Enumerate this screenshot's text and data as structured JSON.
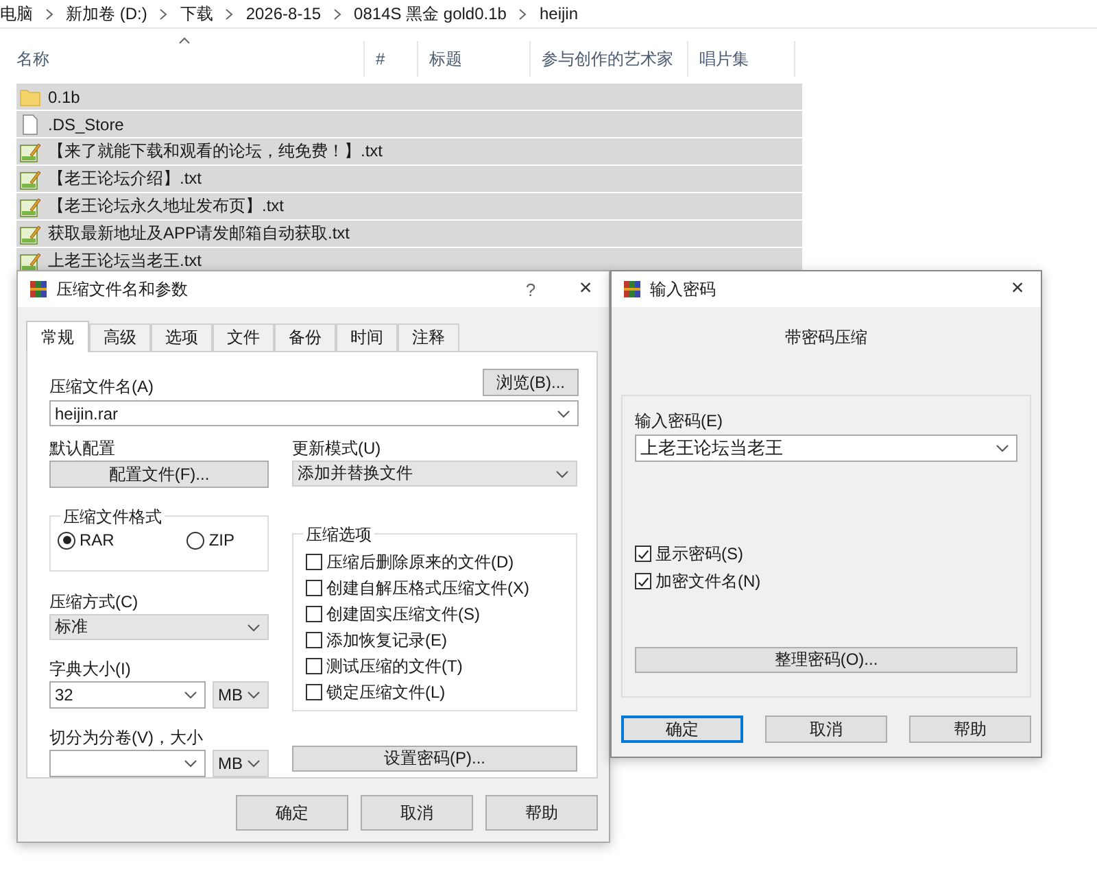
{
  "explorer": {
    "breadcrumb": [
      "电脑",
      "新加卷 (D:)",
      "下载",
      "2026-8-15",
      "0814S 黑金 gold0.1b",
      "heijin"
    ],
    "columns": [
      "名称",
      "#",
      "标题",
      "参与创作的艺术家",
      "唱片集"
    ],
    "files": [
      {
        "name": "0.1b",
        "kind": "folder",
        "selected": true
      },
      {
        "name": ".DS_Store",
        "kind": "file",
        "selected": true
      },
      {
        "name": "【来了就能下载和观看的论坛，纯免费！】.txt",
        "kind": "text",
        "selected": true
      },
      {
        "name": "【老王论坛介绍】.txt",
        "kind": "text",
        "selected": true
      },
      {
        "name": "【老王论坛永久地址发布页】.txt",
        "kind": "text",
        "selected": true
      },
      {
        "name": "获取最新地址及APP请发邮箱自动获取.txt",
        "kind": "text",
        "selected": true
      },
      {
        "name": "上老王论坛当老王.txt",
        "kind": "text",
        "selected": true
      }
    ]
  },
  "archive_dialog": {
    "title": "压缩文件名和参数",
    "help": "?",
    "close": "×",
    "tabs": [
      {
        "label": "常规",
        "selected": true
      },
      {
        "label": "高级",
        "selected": false
      },
      {
        "label": "选项",
        "selected": false
      },
      {
        "label": "文件",
        "selected": false
      },
      {
        "label": "备份",
        "selected": false
      },
      {
        "label": "时间",
        "selected": false
      },
      {
        "label": "注释",
        "selected": false
      }
    ],
    "archive_name": {
      "label": "压缩文件名(A)",
      "value": "heijin.rar",
      "browse": "浏览(B)..."
    },
    "profile": {
      "label": "默认配置",
      "button": "配置文件(F)..."
    },
    "update_mode": {
      "label": "更新模式(U)",
      "value": "添加并替换文件",
      "editable": false
    },
    "format": {
      "title": "压缩文件格式",
      "options": [
        {
          "label": "RAR",
          "selected": true
        },
        {
          "label": "ZIP",
          "selected": false
        }
      ]
    },
    "method": {
      "label": "压缩方式(C)",
      "value": "标准",
      "editable": false
    },
    "dictionary": {
      "label": "字典大小(I)",
      "value": "32",
      "unit": "MB"
    },
    "split": {
      "label": "切分为分卷(V)，大小",
      "unit": "MB"
    },
    "options": {
      "title": "压缩选项",
      "items": [
        {
          "label": "压缩后删除原来的文件(D)",
          "checked": false
        },
        {
          "label": "创建自解压格式压缩文件(X)",
          "checked": false
        },
        {
          "label": "创建固实压缩文件(S)",
          "checked": false
        },
        {
          "label": "添加恢复记录(E)",
          "checked": false
        },
        {
          "label": "测试压缩的文件(T)",
          "checked": false
        },
        {
          "label": "锁定压缩文件(L)",
          "checked": false
        }
      ]
    },
    "set_password": "设置密码(P)...",
    "buttons": [
      {
        "label": "确定",
        "default": false
      },
      {
        "label": "取消",
        "default": false
      },
      {
        "label": "帮助",
        "default": false
      }
    ]
  },
  "password_dialog": {
    "title": "输入密码",
    "close": "×",
    "heading": "带密码压缩",
    "password": {
      "label": "输入密码(E)",
      "value": "上老王论坛当老王"
    },
    "checkboxes": [
      {
        "label": "显示密码(S)",
        "checked": true
      },
      {
        "label": "加密文件名(N)",
        "checked": true
      }
    ],
    "organize": "整理密码(O)...",
    "buttons": [
      {
        "label": "确定",
        "default": true
      },
      {
        "label": "取消",
        "default": false
      },
      {
        "label": "帮助",
        "default": false
      }
    ]
  }
}
